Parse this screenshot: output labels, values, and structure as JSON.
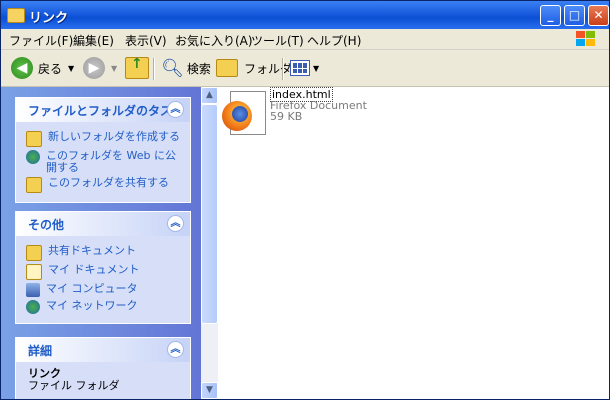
{
  "window": {
    "title": "リンク"
  },
  "titlebar_buttons": {
    "minimize": "_",
    "maximize": "□",
    "close": "✕"
  },
  "menu": [
    "ファイル(F)",
    "編集(E)",
    "表示(V)",
    "お気に入り(A)",
    "ツール(T)",
    "ヘルプ(H)"
  ],
  "toolbar": {
    "back": "戻る",
    "search": "検索",
    "folders": "フォルダ"
  },
  "tasks_panel": {
    "title": "ファイルとフォルダのタスク",
    "items": [
      "新しいフォルダを作成する",
      "このフォルダを Web に公開する",
      "このフォルダを共有する"
    ]
  },
  "other_panel": {
    "title": "その他",
    "items": [
      "共有ドキュメント",
      "マイ ドキュメント",
      "マイ コンピュータ",
      "マイ ネットワーク"
    ]
  },
  "details_panel": {
    "title": "詳細",
    "name": "リンク",
    "type": "ファイル フォルダ"
  },
  "file": {
    "name": "index.html",
    "type": "Firefox Document",
    "size": "59 KB"
  },
  "colors": {
    "titlebar": "#0b4fd4",
    "panel_link": "#215dc6",
    "pane_bg": "#6375d6"
  }
}
